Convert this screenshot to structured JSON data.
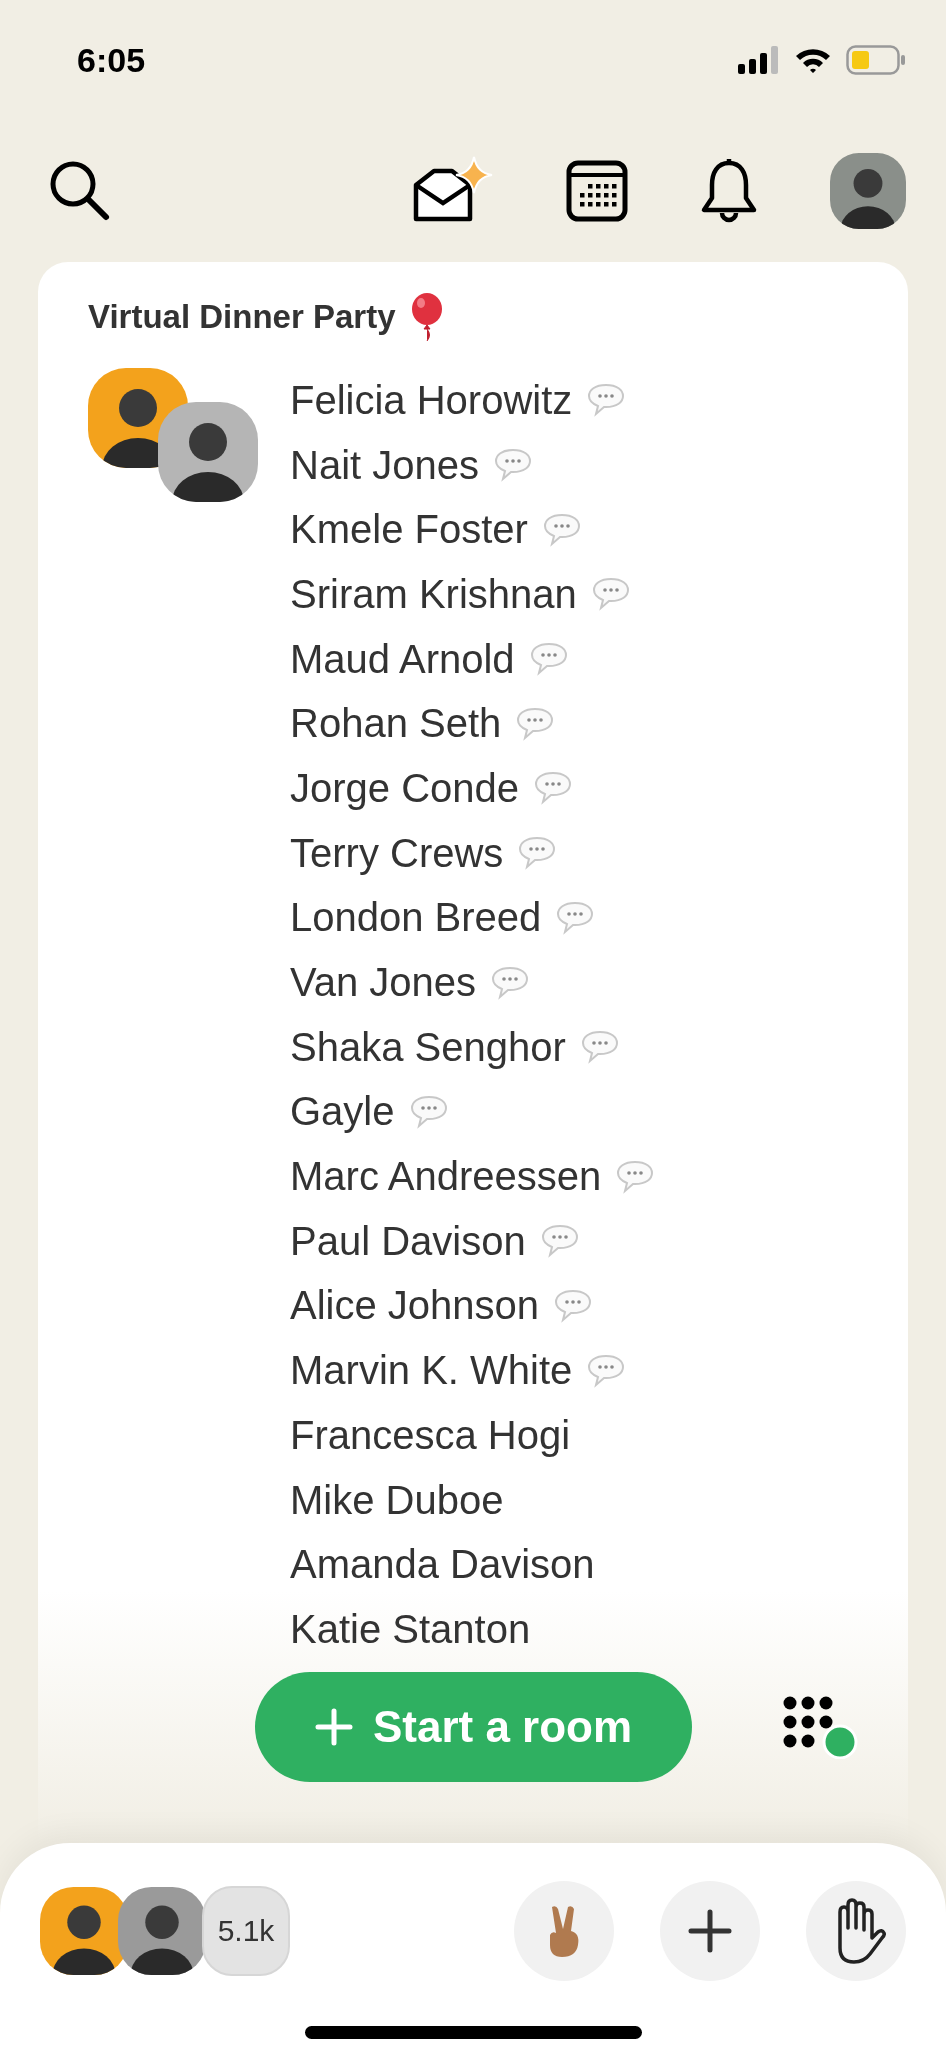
{
  "status_bar": {
    "time": "6:05"
  },
  "room": {
    "title": "Virtual Dinner Party",
    "members": [
      {
        "name": "Felicia Horowitz",
        "speaking": true
      },
      {
        "name": "Nait Jones",
        "speaking": true
      },
      {
        "name": "Kmele Foster",
        "speaking": true
      },
      {
        "name": "Sriram Krishnan",
        "speaking": true
      },
      {
        "name": "Maud Arnold",
        "speaking": true
      },
      {
        "name": "Rohan Seth",
        "speaking": true
      },
      {
        "name": "Jorge Conde",
        "speaking": true
      },
      {
        "name": "Terry Crews",
        "speaking": true
      },
      {
        "name": "London Breed",
        "speaking": true
      },
      {
        "name": "Van Jones",
        "speaking": true
      },
      {
        "name": "Shaka Senghor",
        "speaking": true
      },
      {
        "name": "Gayle",
        "speaking": true
      },
      {
        "name": "Marc Andreessen",
        "speaking": true
      },
      {
        "name": "Paul Davison",
        "speaking": true
      },
      {
        "name": "Alice Johnson",
        "speaking": true
      },
      {
        "name": "Marvin K. White",
        "speaking": true
      },
      {
        "name": "Francesca Hogi",
        "speaking": false
      },
      {
        "name": "Mike Duboe",
        "speaking": false
      },
      {
        "name": "Amanda Davison",
        "speaking": false
      },
      {
        "name": "Katie Stanton",
        "speaking": false
      }
    ]
  },
  "start_button": {
    "label": "Start a room"
  },
  "bottom_bar": {
    "listener_count": "5.1k"
  }
}
